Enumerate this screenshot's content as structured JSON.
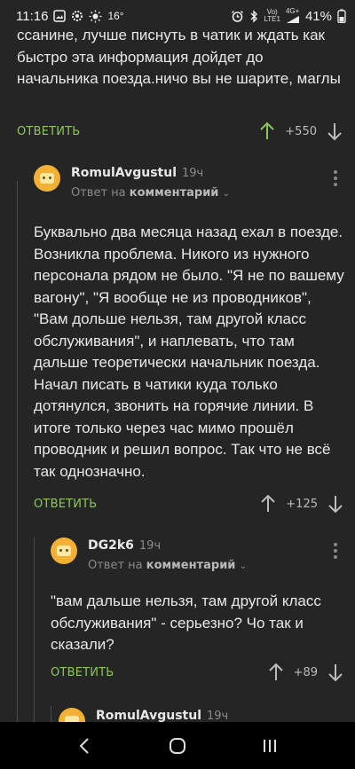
{
  "status_bar": {
    "time": "11:16",
    "temperature": "16°",
    "network_top": "Vo)",
    "network_bottom": "LTE1",
    "network_type": "4G+",
    "battery": "41%",
    "icons": [
      "gallery-icon",
      "settings-icon",
      "sun-icon",
      "alarm-icon",
      "bluetooth-icon",
      "signal-icon",
      "battery-icon"
    ]
  },
  "comments": [
    {
      "text": "ссанине, лучше писнуть в чатик и ждать как быстро эта информация дойдет до начальника поезда.ничо вы не шарите, маглы",
      "reply_label": "ОТВЕТИТЬ",
      "votes": "+550"
    },
    {
      "username": "RomulAvgustul",
      "time": "19ч",
      "reply_to_prefix": "Ответ на",
      "reply_to_target": "комментарий",
      "text": "Буквально два месяца назад ехал в поезде. Возникла проблема. Никого из нужного персонала рядом не было. \"Я не по вашему вагону\", \"Я вообще не из проводников\", \"Вам дольше нельзя, там другой класс обслуживания\", и наплевать, что там дальше теоретически начальник поезда. Начал писать в чатики куда только дотянулся, звонить на горячие линии. В итоге только через час мимо прошёл проводник и решил вопрос. Так что не всё так однозначно.",
      "reply_label": "ОТВЕТИТЬ",
      "votes": "+125"
    },
    {
      "username": "DG2k6",
      "time": "19ч",
      "reply_to_prefix": "Ответ на",
      "reply_to_target": "комментарий",
      "text": "\"вам дальше нельзя, там другой класс обслуживания\" - серьезно? Чо так и сказали?",
      "reply_label": "ОТВЕТИТЬ",
      "votes": "+89"
    },
    {
      "username": "RomulAvgustul",
      "time": "19ч"
    }
  ],
  "colors": {
    "background": "#252526",
    "accent_green": "#8ac858",
    "avatar_yellow": "#f2b134"
  },
  "nav_bar": {
    "back": "back-icon",
    "home": "home-icon",
    "recents": "recents-icon"
  }
}
